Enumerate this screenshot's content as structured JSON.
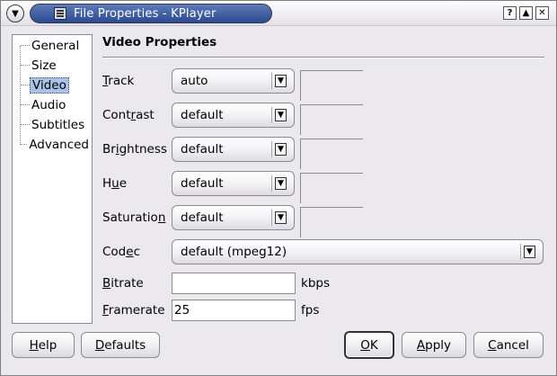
{
  "window": {
    "title": "File Properties - KPlayer",
    "buttons": {
      "help": "?",
      "maximize": "▲",
      "close": "✕"
    },
    "menu_glyph": "▼"
  },
  "tree": {
    "items": [
      {
        "label": "General",
        "selected": false
      },
      {
        "label": "Size",
        "selected": false
      },
      {
        "label": "Video",
        "selected": true
      },
      {
        "label": "Audio",
        "selected": false
      },
      {
        "label": "Subtitles",
        "selected": false
      },
      {
        "label": "Advanced",
        "selected": false
      }
    ]
  },
  "panel": {
    "title": "Video Properties",
    "track": {
      "label_pre": "",
      "label_u": "T",
      "label_post": "rack",
      "value": "auto"
    },
    "contrast": {
      "label_pre": "Cont",
      "label_u": "r",
      "label_post": "ast",
      "value": "default"
    },
    "brightness": {
      "label_pre": "Br",
      "label_u": "i",
      "label_post": "ghtness",
      "value": "default"
    },
    "hue": {
      "label_pre": "H",
      "label_u": "u",
      "label_post": "e",
      "value": "default"
    },
    "saturation": {
      "label_pre": "Saturatio",
      "label_u": "n",
      "label_post": "",
      "value": "default"
    },
    "codec": {
      "label_pre": "Cod",
      "label_u": "e",
      "label_post": "c",
      "value": "default (mpeg12)"
    },
    "bitrate": {
      "label_pre": "",
      "label_u": "B",
      "label_post": "itrate",
      "value": "",
      "unit": "kbps"
    },
    "framerate": {
      "label_pre": "",
      "label_u": "F",
      "label_post": "ramerate",
      "value": "25",
      "unit": "fps"
    },
    "combo_glyph": "▼"
  },
  "buttons": {
    "help": {
      "pre": "",
      "u": "H",
      "post": "elp"
    },
    "defaults": {
      "pre": "",
      "u": "D",
      "post": "efaults"
    },
    "ok": {
      "pre": "",
      "u": "O",
      "post": "K"
    },
    "apply": {
      "pre": "",
      "u": "A",
      "post": "pply"
    },
    "cancel": {
      "pre": "",
      "u": "C",
      "post": "ancel"
    }
  }
}
